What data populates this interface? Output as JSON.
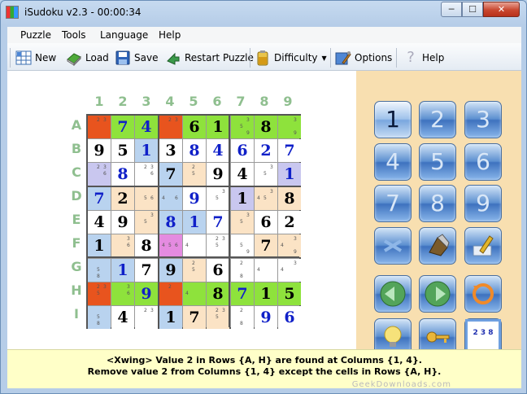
{
  "window": {
    "title": "iSudoku v2.3 - 00:00:34",
    "min": "─",
    "max": "☐",
    "close": "✕"
  },
  "menu": [
    "Puzzle",
    "Tools",
    "Language",
    "Help"
  ],
  "toolbar": {
    "new": "New",
    "load": "Load",
    "save": "Save",
    "restart": "Restart Puzzle",
    "difficulty": "Difficulty",
    "options": "Options",
    "help": "Help"
  },
  "columns": [
    "1",
    "2",
    "3",
    "4",
    "5",
    "6",
    "7",
    "8",
    "9"
  ],
  "rows": [
    "A",
    "B",
    "C",
    "D",
    "E",
    "F",
    "G",
    "H",
    "I"
  ],
  "colors": {
    "orange": "#e8541e",
    "green": "#8ee23c",
    "white": "#ffffff",
    "blue": "#b9d3ef",
    "peach": "#fbe3c5",
    "lavender": "#c9c7ef",
    "pink": "#e48be0"
  },
  "grid": [
    [
      {
        "bg": "orange",
        "c": "2 3"
      },
      {
        "bg": "green",
        "v": "7",
        "g": 0
      },
      {
        "bg": "green",
        "v": "4",
        "g": 0
      },
      {
        "bg": "orange",
        "c": "2 3"
      },
      {
        "bg": "green",
        "v": "6",
        "g": 1
      },
      {
        "bg": "green",
        "v": "1",
        "g": 1
      },
      {
        "bg": "green",
        "c": "3 5 9"
      },
      {
        "bg": "green",
        "v": "8",
        "g": 1
      },
      {
        "bg": "green",
        "c": "3 9"
      }
    ],
    [
      {
        "bg": "white",
        "v": "9",
        "g": 1
      },
      {
        "bg": "white",
        "v": "5",
        "g": 1
      },
      {
        "bg": "blue",
        "v": "1",
        "g": 0
      },
      {
        "bg": "white",
        "v": "3",
        "g": 1
      },
      {
        "bg": "white",
        "v": "8",
        "g": 0
      },
      {
        "bg": "white",
        "v": "4",
        "g": 0
      },
      {
        "bg": "white",
        "v": "6",
        "g": 0
      },
      {
        "bg": "white",
        "v": "2",
        "g": 0
      },
      {
        "bg": "white",
        "v": "7",
        "g": 0
      }
    ],
    [
      {
        "bg": "lavender",
        "c": "2 3 6"
      },
      {
        "bg": "white",
        "v": "8",
        "g": 0
      },
      {
        "bg": "white",
        "c": "2 3 6"
      },
      {
        "bg": "blue",
        "v": "7",
        "g": 1
      },
      {
        "bg": "peach",
        "c": "2 5"
      },
      {
        "bg": "white",
        "v": "9",
        "g": 1
      },
      {
        "bg": "white",
        "v": "4",
        "g": 1
      },
      {
        "bg": "white",
        "c": "5 3"
      },
      {
        "bg": "lavender",
        "v": "1",
        "g": 0
      }
    ],
    [
      {
        "bg": "blue",
        "v": "7",
        "g": 0
      },
      {
        "bg": "peach",
        "v": "2",
        "g": 1
      },
      {
        "bg": "peach",
        "c": "5 6"
      },
      {
        "bg": "blue",
        "c": "4 6"
      },
      {
        "bg": "white",
        "v": "9",
        "g": 0
      },
      {
        "bg": "white",
        "c": "5 3"
      },
      {
        "bg": "lavender",
        "v": "1",
        "g": 1
      },
      {
        "bg": "peach",
        "c": "4 5 3"
      },
      {
        "bg": "peach",
        "v": "8",
        "g": 1
      }
    ],
    [
      {
        "bg": "white",
        "v": "4",
        "g": 1
      },
      {
        "bg": "white",
        "v": "9",
        "g": 1
      },
      {
        "bg": "peach",
        "c": "5 3"
      },
      {
        "bg": "blue",
        "v": "8",
        "g": 0
      },
      {
        "bg": "blue",
        "v": "1",
        "g": 0
      },
      {
        "bg": "white",
        "v": "7",
        "g": 0
      },
      {
        "bg": "peach",
        "c": "5 3"
      },
      {
        "bg": "white",
        "v": "6",
        "g": 1
      },
      {
        "bg": "white",
        "v": "2",
        "g": 1
      }
    ],
    [
      {
        "bg": "blue",
        "v": "1",
        "g": 1
      },
      {
        "bg": "peach",
        "c": "3 6"
      },
      {
        "bg": "white",
        "v": "8",
        "g": 1
      },
      {
        "bg": "pink",
        "c": "4 5 6"
      },
      {
        "bg": "white",
        "c": "4"
      },
      {
        "bg": "white",
        "c": "2 3 5"
      },
      {
        "bg": "white",
        "c": "5 9"
      },
      {
        "bg": "peach",
        "v": "7",
        "g": 1
      },
      {
        "bg": "peach",
        "c": "4 3 9"
      }
    ],
    [
      {
        "bg": "blue",
        "c": "5 8"
      },
      {
        "bg": "blue",
        "v": "1",
        "g": 0
      },
      {
        "bg": "white",
        "v": "7",
        "g": 1
      },
      {
        "bg": "blue",
        "v": "9",
        "g": 1
      },
      {
        "bg": "peach",
        "c": "2 5"
      },
      {
        "bg": "white",
        "v": "6",
        "g": 1
      },
      {
        "bg": "white",
        "c": "2 8"
      },
      {
        "bg": "white",
        "c": "4"
      },
      {
        "bg": "white",
        "c": "4 3"
      }
    ],
    [
      {
        "bg": "orange",
        "c": "2 3 5"
      },
      {
        "bg": "green",
        "c": "3 6"
      },
      {
        "bg": "green",
        "v": "9",
        "g": 0
      },
      {
        "bg": "orange",
        "c": "2"
      },
      {
        "bg": "green",
        "c": "4"
      },
      {
        "bg": "green",
        "v": "8",
        "g": 1
      },
      {
        "bg": "green",
        "v": "7",
        "g": 0
      },
      {
        "bg": "green",
        "v": "1",
        "g": 1
      },
      {
        "bg": "green",
        "v": "5",
        "g": 1
      }
    ],
    [
      {
        "bg": "blue",
        "c": "5 8"
      },
      {
        "bg": "white",
        "v": "4",
        "g": 1
      },
      {
        "bg": "white",
        "c": "2 3"
      },
      {
        "bg": "blue",
        "v": "1",
        "g": 1
      },
      {
        "bg": "peach",
        "v": "7",
        "g": 1
      },
      {
        "bg": "peach",
        "c": "2 3 5"
      },
      {
        "bg": "white",
        "c": "2 8"
      },
      {
        "bg": "white",
        "v": "9",
        "g": 0
      },
      {
        "bg": "white",
        "v": "6",
        "g": 0
      }
    ]
  ],
  "keypad": {
    "numbers": [
      "1",
      "2",
      "3",
      "4",
      "5",
      "6",
      "7",
      "8",
      "9"
    ],
    "selected": "1",
    "tools": [
      "erase-icon",
      "pen-icon",
      "pencil-icon",
      "undo-icon",
      "redo-icon",
      "refresh-icon",
      "hint-icon",
      "key-icon",
      "candidates-icon"
    ],
    "tool_label": "2 3 8"
  },
  "status": {
    "line1": "<Xwing> Value 2 in Rows {A, H} are found at Columns {1, 4}.",
    "line2": "Remove value 2 from Columns {1, 4} except the cells in Rows {A, H}."
  },
  "watermark": "GeekDownloads.com"
}
